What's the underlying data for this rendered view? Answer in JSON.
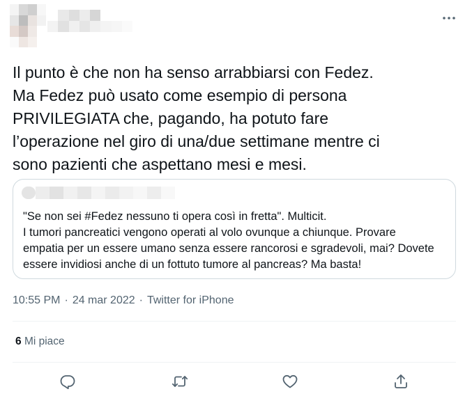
{
  "tweet": {
    "text_lines": [
      "Il punto è che non ha senso arrabbiarsi con Fedez.",
      "Ma Fedez può usato come esempio di persona",
      "PRIVILEGIATA che, pagando, ha potuto fare",
      "l’operazione nel giro di una/due settimane mentre ci",
      "sono pazienti che aspettano mesi e mesi."
    ],
    "quoted": {
      "text_lines": [
        "\"Se non sei #Fedez nessuno ti opera così in fretta\". Multicit.",
        "I tumori pancreatici vengono operati al volo ovunque a chiunque. Provare",
        "empatia per un essere umano senza essere rancorosi e sgradevoli, mai? Dovete",
        "essere invidiosi anche di un fottuto tumore al pancreas? Ma basta!"
      ]
    },
    "time": "10:55 PM",
    "separator": "·",
    "date": "24 mar 2022",
    "source": "Twitter for iPhone",
    "likes_count": "6",
    "likes_label": "Mi piace"
  },
  "icons": {
    "more": "more-horizontal-icon",
    "reply": "reply-icon",
    "retweet": "retweet-icon",
    "like": "heart-icon",
    "share": "share-icon"
  },
  "colors": {
    "text": "#0f1419",
    "secondary": "#536471",
    "border": "#cfd9de",
    "divider": "#eff3f4"
  }
}
